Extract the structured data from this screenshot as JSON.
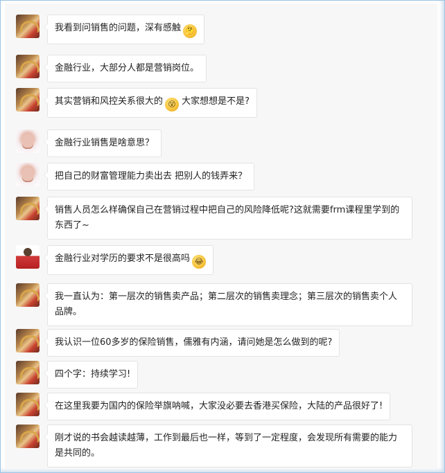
{
  "messages": [
    {
      "avatar": "avatar-a",
      "text": "我看到问销售的问题，深有感触",
      "emoji": "thinking-face-icon",
      "glyph": "🤔"
    },
    {
      "avatar": "avatar-a",
      "text": "金融行业，大部分人都是营销岗位。"
    },
    {
      "avatar": "avatar-a",
      "text": "其实营销和风控关系很大的",
      "emoji": "dizzy-face-icon",
      "glyph": "😵",
      "text_after": "大家想想是不是?"
    },
    {
      "avatar": "avatar-b",
      "text": "金融行业销售是啥意思？"
    },
    {
      "avatar": "avatar-b",
      "text": "把自己的财富管理能力卖出去 把别人的钱弄来？"
    },
    {
      "avatar": "avatar-a",
      "text": "销售人员怎么样确保自己在营销过程中把自己的风险降低呢?这就需要frm课程里学到的东西了~"
    },
    {
      "avatar": "avatar-c",
      "text": "金融行业对学历的要求不是很高吗",
      "emoji": "laughing-tears-icon",
      "glyph": "😂"
    },
    {
      "avatar": "avatar-a",
      "text": "我一直认为：第一层次的销售卖产品；第二层次的销售卖理念；第三层次的销售卖个人品牌。"
    },
    {
      "avatar": "avatar-a",
      "text": "我认识一位60多岁的保险销售，儒雅有内涵，请问她是怎么做到的呢?"
    },
    {
      "avatar": "avatar-a",
      "text": "四个字：持续学习!"
    },
    {
      "avatar": "avatar-a",
      "text": "在这里我要为国内的保险举旗呐喊，大家没必要去香港买保险，大陆的产品很好了!"
    },
    {
      "avatar": "avatar-a",
      "text": "刚才说的书会越读越薄，工作到最后也一样，等到了一定程度，会发现所有需要的能力是共同的。"
    }
  ],
  "colors": {
    "frame_border": "#9bc4e6",
    "panel_bg": "#f7f7f7",
    "bubble_bg": "#ffffff",
    "bubble_border": "#e3e3e3"
  }
}
